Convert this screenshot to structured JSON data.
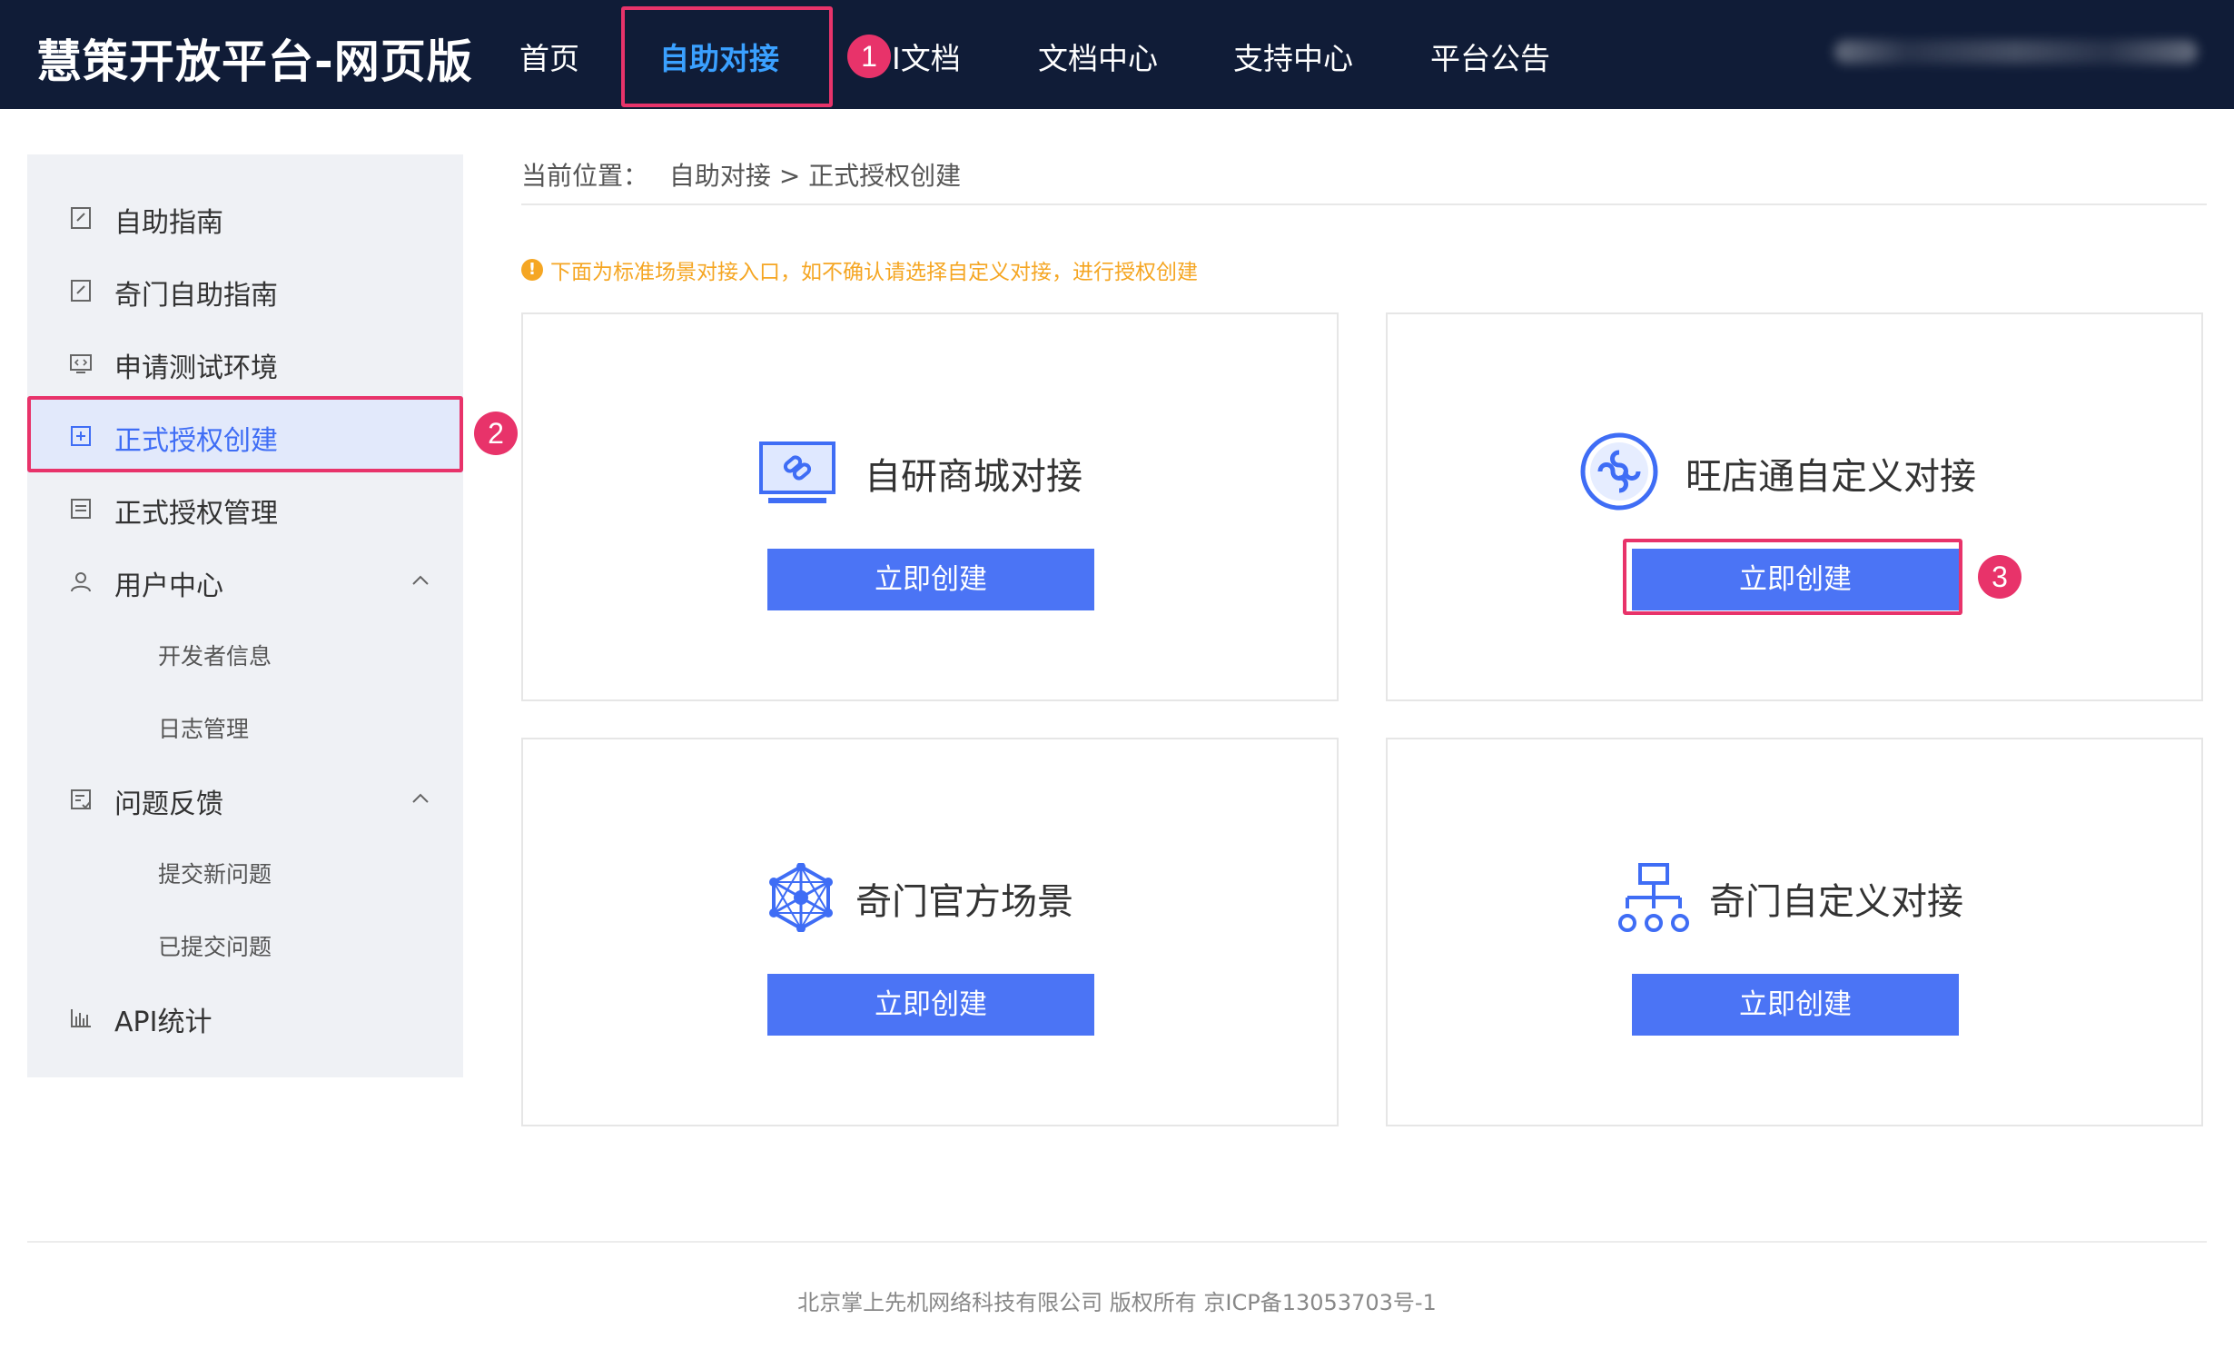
{
  "header": {
    "brand": "慧策开放平台-网页版",
    "nav": [
      {
        "label": "首页"
      },
      {
        "label": "自助对接",
        "active": true
      },
      {
        "label": "I文档"
      },
      {
        "label": "文档中心"
      },
      {
        "label": "支持中心"
      },
      {
        "label": "平台公告"
      }
    ]
  },
  "badges": [
    "1",
    "2",
    "3"
  ],
  "sidebar": {
    "items": [
      {
        "label": "自助指南",
        "icon": "edit-doc-icon"
      },
      {
        "label": "奇门自助指南",
        "icon": "edit-doc-icon"
      },
      {
        "label": "申请测试环境",
        "icon": "code-screen-icon"
      },
      {
        "label": "正式授权创建",
        "icon": "add-box-icon",
        "active": true
      },
      {
        "label": "正式授权管理",
        "icon": "list-doc-icon"
      },
      {
        "label": "用户中心",
        "icon": "user-icon",
        "expanded": true
      },
      {
        "label": "开发者信息"
      },
      {
        "label": "日志管理"
      },
      {
        "label": "问题反馈",
        "icon": "feedback-icon",
        "expanded": true
      },
      {
        "label": "提交新问题"
      },
      {
        "label": "已提交问题"
      },
      {
        "label": "API统计",
        "icon": "bar-chart-icon"
      }
    ]
  },
  "breadcrumb": {
    "prefix": "当前位置：",
    "path": "自助对接 > 正式授权创建"
  },
  "notice": "下面为标准场景对接入口，如不确认请选择自定义对接，进行授权创建",
  "cards": [
    {
      "title": "自研商城对接",
      "button": "立即创建",
      "icon": "link-monitor-icon"
    },
    {
      "title": "旺店通自定义对接",
      "button": "立即创建",
      "icon": "wdt-logo-icon"
    },
    {
      "title": "奇门官方场景",
      "button": "立即创建",
      "icon": "network-hexagon-icon"
    },
    {
      "title": "奇门自定义对接",
      "button": "立即创建",
      "icon": "org-chart-icon"
    }
  ],
  "footer": "北京掌上先机网络科技有限公司 版权所有 京ICP备13053703号-1",
  "colors": {
    "header_bg": "#101c37",
    "accent": "#4b74f5",
    "nav_active": "#3aa0ff",
    "highlight": "#e8336a",
    "notice": "#f5a623"
  }
}
